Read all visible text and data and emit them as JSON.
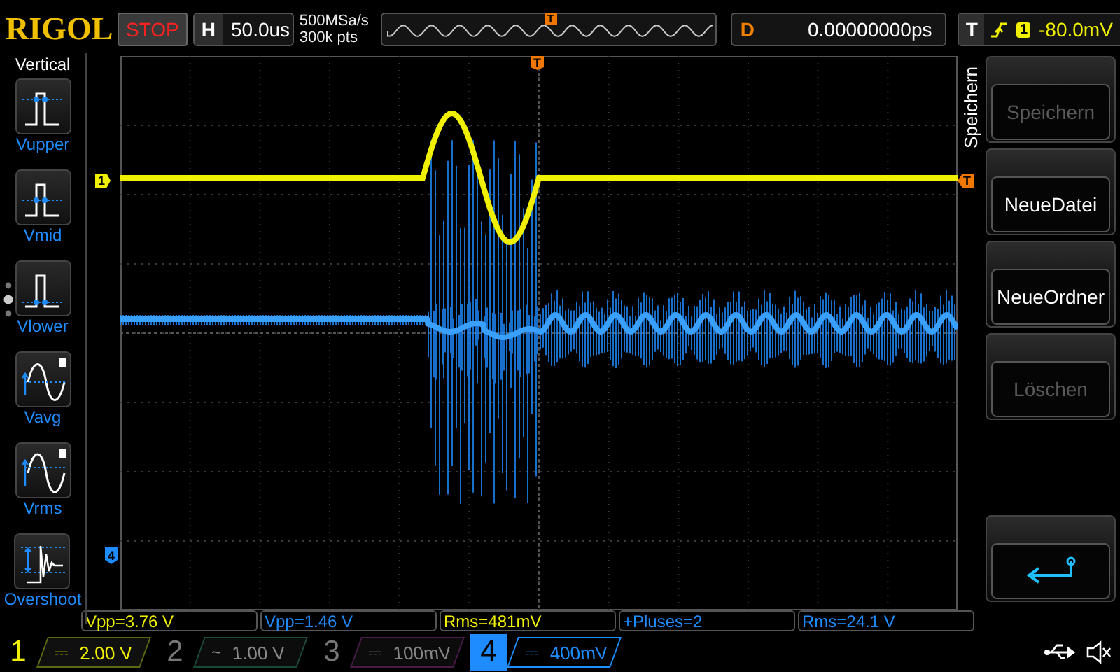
{
  "header": {
    "brand": "RIGOL",
    "run_state": "STOP",
    "timebase_label": "H",
    "timebase": "50.0us",
    "sample_rate": "500MSa/s",
    "memory_depth": "300k pts",
    "overview_trigger_marker": "T",
    "delay_label": "D",
    "delay": "0.00000000ps",
    "trigger_label": "T",
    "trigger_source": "1",
    "trigger_level": "-80.0mV"
  },
  "sidebar": {
    "title": "Vertical",
    "items": [
      {
        "label": "Vupper",
        "kind": "upper"
      },
      {
        "label": "Vmid",
        "kind": "mid"
      },
      {
        "label": "Vlower",
        "kind": "lower"
      },
      {
        "label": "Vavg",
        "kind": "avg"
      },
      {
        "label": "Vrms",
        "kind": "rms"
      },
      {
        "label": "Overshoot",
        "kind": "overshoot"
      }
    ]
  },
  "plot": {
    "channel_marker": "1",
    "ground_marker": "4",
    "trigger_position_marker": "T",
    "trigger_level_marker": "T"
  },
  "softkeys": {
    "title": "Speichern",
    "items": [
      {
        "kind": "label",
        "label": "Speichern",
        "disabled": true
      },
      {
        "kind": "label",
        "label": "NeueDatei",
        "disabled": false
      },
      {
        "kind": "label",
        "label": "NeueOrdner",
        "disabled": false
      },
      {
        "kind": "label",
        "label": "Löschen",
        "disabled": true
      },
      {
        "kind": "back",
        "disabled": false
      }
    ]
  },
  "measurements": [
    {
      "text": "Vpp=3.76 V",
      "color": "#f0f000"
    },
    {
      "text": "Vpp=1.46 V",
      "color": "#1e8cff"
    },
    {
      "text": "Rms=481mV",
      "color": "#f0f000"
    },
    {
      "text": "+Pluses=2",
      "color": "#1e8cff"
    },
    {
      "text": "Rms=24.1 V",
      "color": "#1e8cff"
    }
  ],
  "channels": [
    {
      "number": "1",
      "coupling": "⎓",
      "scale": "2.00 V",
      "color": "#5a6a10",
      "enabled": true,
      "selected": false
    },
    {
      "number": "2",
      "coupling": "~",
      "scale": "1.00 V",
      "color": "#1a4a38",
      "enabled": false,
      "selected": false
    },
    {
      "number": "3",
      "coupling": "⎓",
      "scale": "100mV",
      "color": "#4a1a48",
      "enabled": false,
      "selected": false
    },
    {
      "number": "4",
      "coupling": "⎓",
      "scale": "400mV",
      "color": "#1e8cff",
      "enabled": true,
      "selected": true
    }
  ]
}
